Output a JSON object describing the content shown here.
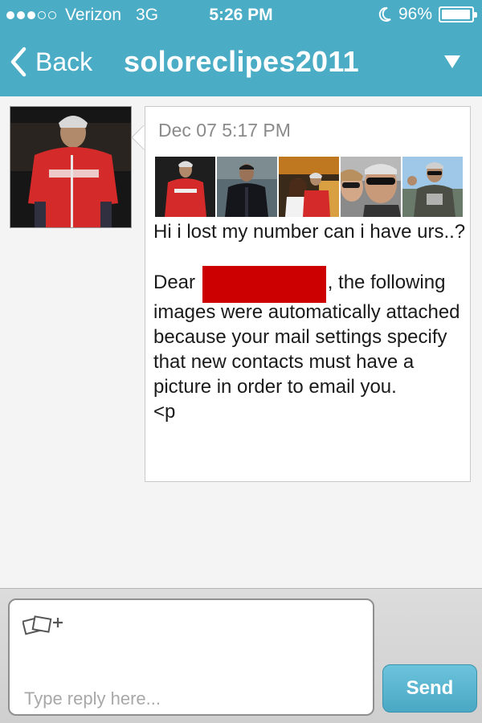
{
  "status_bar": {
    "carrier": "Verizon",
    "network": "3G",
    "time": "5:26 PM",
    "battery": "96%",
    "battery_level": 0.96,
    "signal_bars_filled": 3,
    "signal_bars_total": 5
  },
  "nav": {
    "back_label": "Back",
    "title": "soloreclipes2011"
  },
  "message": {
    "date": "Dec 07 5:17 PM",
    "line1": "Hi i lost my number can i have urs..?",
    "dear_prefix": "Dear",
    "dear_suffix": ", the following images were automatically attached because your mail settings specify that new contacts must have a picture in order to email you.",
    "tail": "<p",
    "attachment_count": 5
  },
  "reply": {
    "placeholder": "Type reply here...",
    "send_label": "Send"
  },
  "colors": {
    "header": "#4bacc6",
    "send_button": "#4aa8c4",
    "redaction": "#cc0000"
  }
}
